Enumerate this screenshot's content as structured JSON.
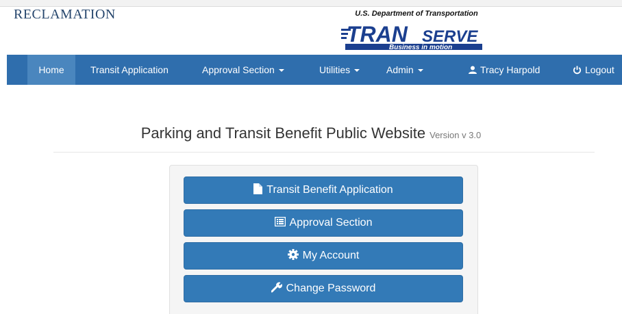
{
  "header": {
    "agency": "RECLAMATION",
    "logo_subtitle": "U.S. Department of Transportation",
    "logo_title_a": "TRAN",
    "logo_title_b": "SERVE",
    "logo_tagline": "Business in motion"
  },
  "navbar": {
    "items": [
      {
        "label": "Home",
        "active": true
      },
      {
        "label": "Transit Application"
      },
      {
        "label": "Approval Section",
        "dropdown": true
      },
      {
        "label": "Utilities",
        "dropdown": true
      },
      {
        "label": "Admin",
        "dropdown": true
      }
    ],
    "user": {
      "label": "Tracy Harpold",
      "icon": "user-icon"
    },
    "logout": {
      "label": "Logout",
      "icon": "power-icon"
    }
  },
  "page": {
    "title": "Parking and Transit Benefit Public Website",
    "version": "Version v 3.0"
  },
  "actions": [
    {
      "label": "Transit Benefit Application",
      "icon": "file-icon"
    },
    {
      "label": "Approval Section",
      "icon": "list-alt-icon"
    },
    {
      "label": "My Account",
      "icon": "cog-icon"
    },
    {
      "label": "Change Password",
      "icon": "wrench-icon"
    }
  ],
  "colors": {
    "navbar": "#2f6ead",
    "navbar_active": "#4a86be",
    "button": "#337ab7",
    "logo_blue": "#1b3f8f"
  }
}
